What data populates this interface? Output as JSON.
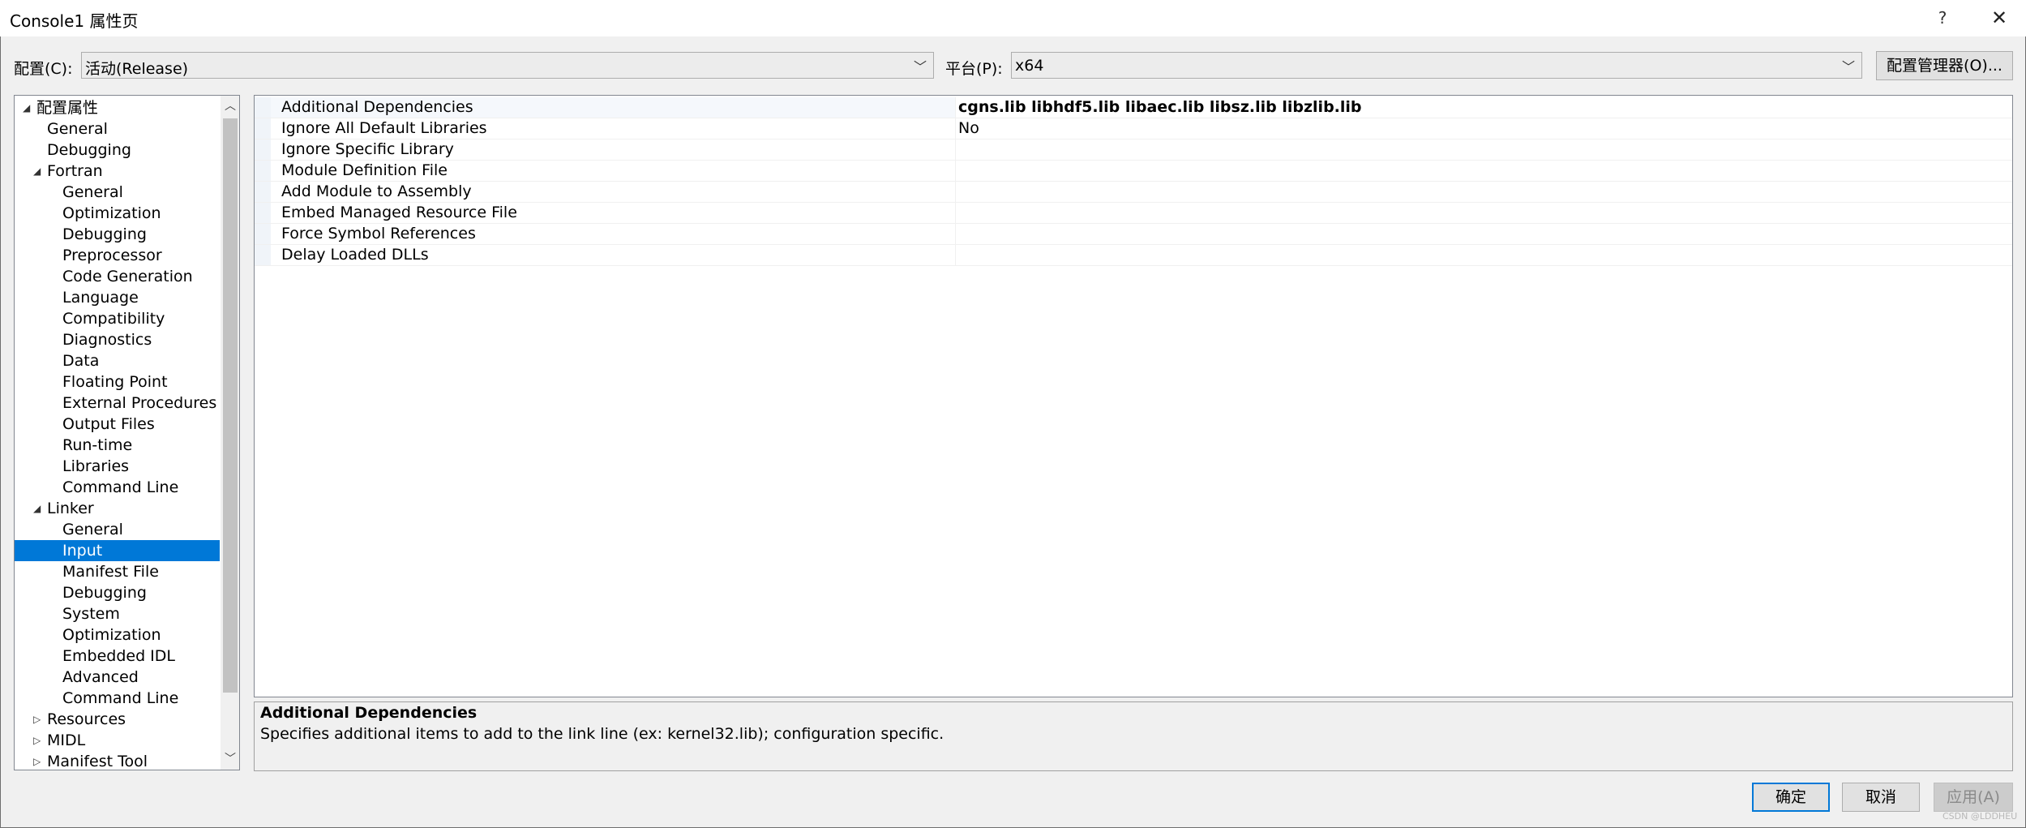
{
  "window": {
    "title": "Console1 属性页",
    "help_glyph": "?",
    "close_glyph": "✕"
  },
  "config_bar": {
    "config_label": "配置(C):",
    "config_value": "活动(Release)",
    "platform_label": "平台(P):",
    "platform_value": "x64",
    "manager_button": "配置管理器(O)..."
  },
  "tree": {
    "items": [
      {
        "label": "配置属性",
        "toggle": "◢"
      },
      {
        "label": "General",
        "toggle": ""
      },
      {
        "label": "Debugging",
        "toggle": ""
      },
      {
        "label": "Fortran",
        "toggle": "◢"
      },
      {
        "label": "General",
        "toggle": ""
      },
      {
        "label": "Optimization",
        "toggle": ""
      },
      {
        "label": "Debugging",
        "toggle": ""
      },
      {
        "label": "Preprocessor",
        "toggle": ""
      },
      {
        "label": "Code Generation",
        "toggle": ""
      },
      {
        "label": "Language",
        "toggle": ""
      },
      {
        "label": "Compatibility",
        "toggle": ""
      },
      {
        "label": "Diagnostics",
        "toggle": ""
      },
      {
        "label": "Data",
        "toggle": ""
      },
      {
        "label": "Floating Point",
        "toggle": ""
      },
      {
        "label": "External Procedures",
        "toggle": ""
      },
      {
        "label": "Output Files",
        "toggle": ""
      },
      {
        "label": "Run-time",
        "toggle": ""
      },
      {
        "label": "Libraries",
        "toggle": ""
      },
      {
        "label": "Command Line",
        "toggle": ""
      },
      {
        "label": "Linker",
        "toggle": "◢"
      },
      {
        "label": "General",
        "toggle": ""
      },
      {
        "label": "Input",
        "toggle": "",
        "selected": true
      },
      {
        "label": "Manifest File",
        "toggle": ""
      },
      {
        "label": "Debugging",
        "toggle": ""
      },
      {
        "label": "System",
        "toggle": ""
      },
      {
        "label": "Optimization",
        "toggle": ""
      },
      {
        "label": "Embedded IDL",
        "toggle": ""
      },
      {
        "label": "Advanced",
        "toggle": ""
      },
      {
        "label": "Command Line",
        "toggle": ""
      },
      {
        "label": "Resources",
        "toggle": "▷"
      },
      {
        "label": "MIDL",
        "toggle": "▷"
      },
      {
        "label": "Manifest Tool",
        "toggle": "▷"
      }
    ]
  },
  "properties": {
    "rows": [
      {
        "name": "Additional Dependencies",
        "value": "cgns.lib libhdf5.lib libaec.lib libsz.lib libzlib.lib",
        "bold": true
      },
      {
        "name": "Ignore All Default Libraries",
        "value": "No",
        "bold": false
      },
      {
        "name": "Ignore Specific Library",
        "value": "",
        "bold": false
      },
      {
        "name": "Module Definition File",
        "value": "",
        "bold": false
      },
      {
        "name": "Add Module to Assembly",
        "value": "",
        "bold": false
      },
      {
        "name": "Embed Managed Resource File",
        "value": "",
        "bold": false
      },
      {
        "name": "Force Symbol References",
        "value": "",
        "bold": false
      },
      {
        "name": "Delay Loaded DLLs",
        "value": "",
        "bold": false
      }
    ]
  },
  "description": {
    "title": "Additional Dependencies",
    "text": "Specifies additional items to add to the link line (ex: kernel32.lib); configuration specific."
  },
  "buttons": {
    "ok": "确定",
    "cancel": "取消",
    "apply": "应用(A)"
  },
  "watermark": "CSDN @LDDHEU",
  "colors": {
    "selection": "#0078d7",
    "window_bg": "#f0f0f0"
  }
}
